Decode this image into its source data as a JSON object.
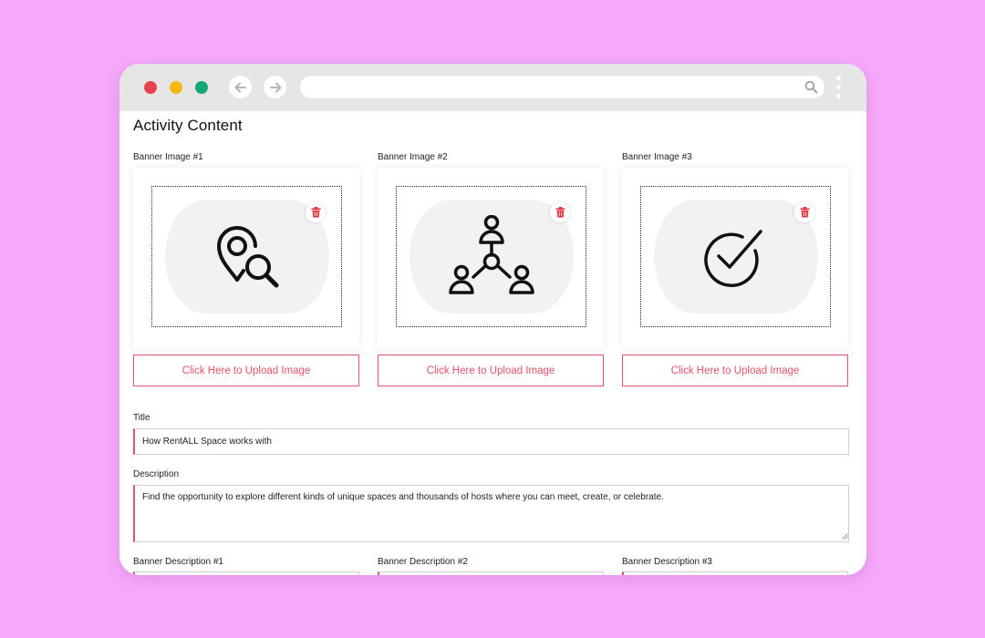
{
  "page": {
    "title": "Activity Content"
  },
  "banners": [
    {
      "label": "Banner Image #1",
      "icon": "location-search-icon",
      "upload_label": "Click Here to Upload Image"
    },
    {
      "label": "Banner Image #2",
      "icon": "people-network-icon",
      "upload_label": "Click Here to Upload Image"
    },
    {
      "label": "Banner Image #3",
      "icon": "check-circle-icon",
      "upload_label": "Click Here to Upload Image"
    }
  ],
  "form": {
    "title_label": "Title",
    "title_value": "How RentALL Space works with",
    "description_label": "Description",
    "description_value": "Find the opportunity to explore different kinds of unique spaces and thousands of hosts where you can meet, create, or celebrate."
  },
  "banner_descriptions": [
    {
      "label": "Banner Description #1"
    },
    {
      "label": "Banner Description #2"
    },
    {
      "label": "Banner Description #3"
    }
  ],
  "colors": {
    "background": "#f6a9fb",
    "accent": "#e0536a",
    "trash": "#e0303c",
    "close_dot": "#e8414f",
    "minimize_dot": "#f5b80f",
    "maximize_dot": "#17a77c"
  }
}
